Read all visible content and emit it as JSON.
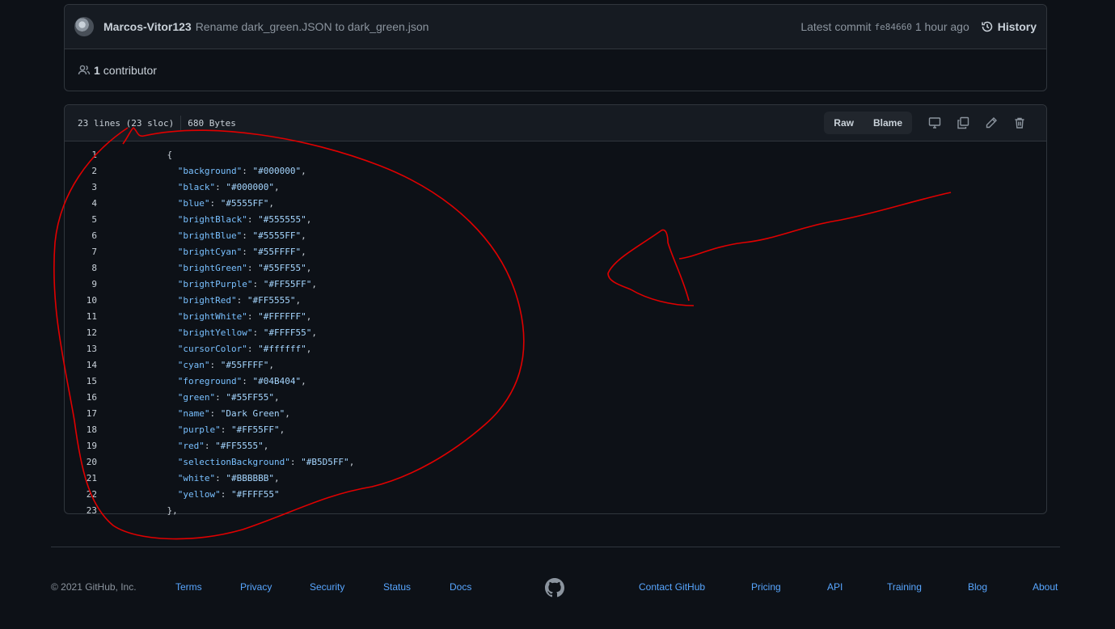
{
  "commit": {
    "author": "Marcos-Vitor123",
    "message": "Rename dark_green.JSON to dark_green.json",
    "latest_label": "Latest commit",
    "sha": "fe84660",
    "time": "1 hour ago",
    "history_label": "History"
  },
  "contributors": {
    "count": "1",
    "label": "contributor"
  },
  "file": {
    "lines_info": "23 lines (23 sloc)",
    "size": "680 Bytes",
    "raw_label": "Raw",
    "blame_label": "Blame"
  },
  "code_lines": [
    {
      "n": "1",
      "indent": "    ",
      "key": "",
      "val": "",
      "text": "{"
    },
    {
      "n": "2",
      "indent": "      ",
      "key": "\"background\"",
      "val": "\"#000000\"",
      "text": ""
    },
    {
      "n": "3",
      "indent": "      ",
      "key": "\"black\"",
      "val": "\"#000000\"",
      "text": ""
    },
    {
      "n": "4",
      "indent": "      ",
      "key": "\"blue\"",
      "val": "\"#5555FF\"",
      "text": ""
    },
    {
      "n": "5",
      "indent": "      ",
      "key": "\"brightBlack\"",
      "val": "\"#555555\"",
      "text": ""
    },
    {
      "n": "6",
      "indent": "      ",
      "key": "\"brightBlue\"",
      "val": "\"#5555FF\"",
      "text": ""
    },
    {
      "n": "7",
      "indent": "      ",
      "key": "\"brightCyan\"",
      "val": "\"#55FFFF\"",
      "text": ""
    },
    {
      "n": "8",
      "indent": "      ",
      "key": "\"brightGreen\"",
      "val": "\"#55FF55\"",
      "text": ""
    },
    {
      "n": "9",
      "indent": "      ",
      "key": "\"brightPurple\"",
      "val": "\"#FF55FF\"",
      "text": ""
    },
    {
      "n": "10",
      "indent": "      ",
      "key": "\"brightRed\"",
      "val": "\"#FF5555\"",
      "text": ""
    },
    {
      "n": "11",
      "indent": "      ",
      "key": "\"brightWhite\"",
      "val": "\"#FFFFFF\"",
      "text": ""
    },
    {
      "n": "12",
      "indent": "      ",
      "key": "\"brightYellow\"",
      "val": "\"#FFFF55\"",
      "text": ""
    },
    {
      "n": "13",
      "indent": "      ",
      "key": "\"cursorColor\"",
      "val": "\"#ffffff\"",
      "text": ""
    },
    {
      "n": "14",
      "indent": "      ",
      "key": "\"cyan\"",
      "val": "\"#55FFFF\"",
      "text": ""
    },
    {
      "n": "15",
      "indent": "      ",
      "key": "\"foreground\"",
      "val": "\"#04B404\"",
      "text": ""
    },
    {
      "n": "16",
      "indent": "      ",
      "key": "\"green\"",
      "val": "\"#55FF55\"",
      "text": ""
    },
    {
      "n": "17",
      "indent": "      ",
      "key": "\"name\"",
      "val": "\"Dark Green\"",
      "text": ""
    },
    {
      "n": "18",
      "indent": "      ",
      "key": "\"purple\"",
      "val": "\"#FF55FF\"",
      "text": ""
    },
    {
      "n": "19",
      "indent": "      ",
      "key": "\"red\"",
      "val": "\"#FF5555\"",
      "text": ""
    },
    {
      "n": "20",
      "indent": "      ",
      "key": "\"selectionBackground\"",
      "val": "\"#B5D5FF\"",
      "text": ""
    },
    {
      "n": "21",
      "indent": "      ",
      "key": "\"white\"",
      "val": "\"#BBBBBB\"",
      "text": ""
    },
    {
      "n": "22",
      "indent": "      ",
      "key": "\"yellow\"",
      "val": "\"#FFFF55\"",
      "text": "",
      "last": true
    },
    {
      "n": "23",
      "indent": "    ",
      "key": "",
      "val": "",
      "text": "},"
    }
  ],
  "footer": {
    "copyright": "© 2021 GitHub, Inc.",
    "left_links": [
      "Terms",
      "Privacy",
      "Security",
      "Status",
      "Docs"
    ],
    "right_links": [
      "Contact GitHub",
      "Pricing",
      "API",
      "Training",
      "Blog",
      "About"
    ]
  },
  "colors": {
    "background": "#0d1117",
    "link": "#58a6ff",
    "annotation": "#e00000"
  },
  "icons": [
    "history-icon",
    "people-icon",
    "desktop-icon",
    "copy-icon",
    "pencil-icon",
    "trash-icon",
    "github-logo-icon"
  ]
}
